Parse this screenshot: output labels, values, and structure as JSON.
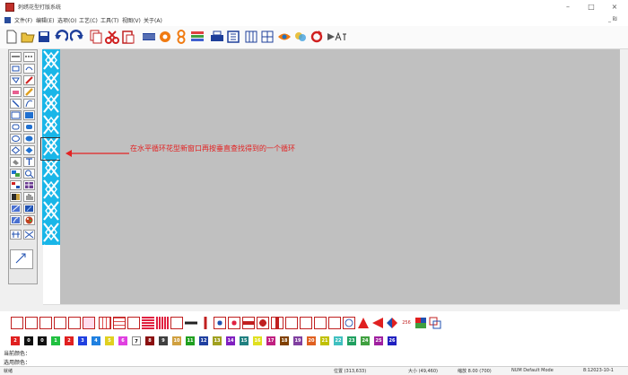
{
  "title_bar": {
    "title": "刺绣花型打版系统"
  },
  "window_controls": {
    "minimize": "–",
    "maximize": "□",
    "close": "×"
  },
  "menu": {
    "items": [
      "文件(F)",
      "编辑(E)",
      "选项(O)",
      "工艺(C)",
      "工具(T)",
      "视图(V)",
      "关于(A)"
    ],
    "mdi_controls": "_ ₪"
  },
  "toolbar": {
    "buttons": [
      "new-icon",
      "open-icon",
      "save-icon",
      "undo-icon",
      "redo-icon",
      "copy-icon",
      "cut-icon",
      "paste-icon",
      "stitch-pattern-icon",
      "gear-icon",
      "loop-icon",
      "stripe-icon",
      "print-icon",
      "preview-icon",
      "columns-icon",
      "grid-icon",
      "eye-icon",
      "color-icon",
      "refresh-icon",
      "play-icon",
      "text-icon"
    ]
  },
  "annotation": {
    "text": "在水平循环花型新窗口再按垂直查找得到的一个循环"
  },
  "palette": {
    "swatches": [
      {
        "label": "2",
        "color": "#e02020"
      },
      {
        "label": "0",
        "color": "#101010"
      },
      {
        "label": "0",
        "color": "#101010"
      },
      {
        "label": "1",
        "color": "#20c040"
      },
      {
        "label": "2",
        "color": "#e02020"
      },
      {
        "label": "3",
        "color": "#2040e0"
      },
      {
        "label": "4",
        "color": "#2080e0"
      },
      {
        "label": "5",
        "color": "#e0d020"
      },
      {
        "label": "6",
        "color": "#e040e0"
      },
      {
        "label": "7",
        "color": "#ffffff"
      },
      {
        "label": "8",
        "color": "#8a1010"
      },
      {
        "label": "9",
        "color": "#404040"
      },
      {
        "label": "10",
        "color": "#d0a040"
      },
      {
        "label": "11",
        "color": "#20a020"
      },
      {
        "label": "12",
        "color": "#2040a0"
      },
      {
        "label": "13",
        "color": "#a0a020"
      },
      {
        "label": "14",
        "color": "#8020c0"
      },
      {
        "label": "15",
        "color": "#208080"
      },
      {
        "label": "16",
        "color": "#e0e020"
      },
      {
        "label": "17",
        "color": "#c02080"
      },
      {
        "label": "18",
        "color": "#804000"
      },
      {
        "label": "19",
        "color": "#8040a0"
      },
      {
        "label": "20",
        "color": "#e06020"
      },
      {
        "label": "21",
        "color": "#c0c000"
      },
      {
        "label": "22",
        "color": "#40c0c0"
      },
      {
        "label": "23",
        "color": "#20a060"
      },
      {
        "label": "24",
        "color": "#40a040"
      },
      {
        "label": "25",
        "color": "#a020a0"
      },
      {
        "label": "26",
        "color": "#2020c0"
      }
    ]
  },
  "info": {
    "row1": "当前颜色：",
    "row2": "选用颜色："
  },
  "status": {
    "ready": "就绪",
    "pos": "位置 (313,633)",
    "size": "大小 (49,460)",
    "zoom": "缩放 8.00 (700)",
    "mode": "NUM  Default Mode",
    "time": "8:12023-10-1"
  }
}
